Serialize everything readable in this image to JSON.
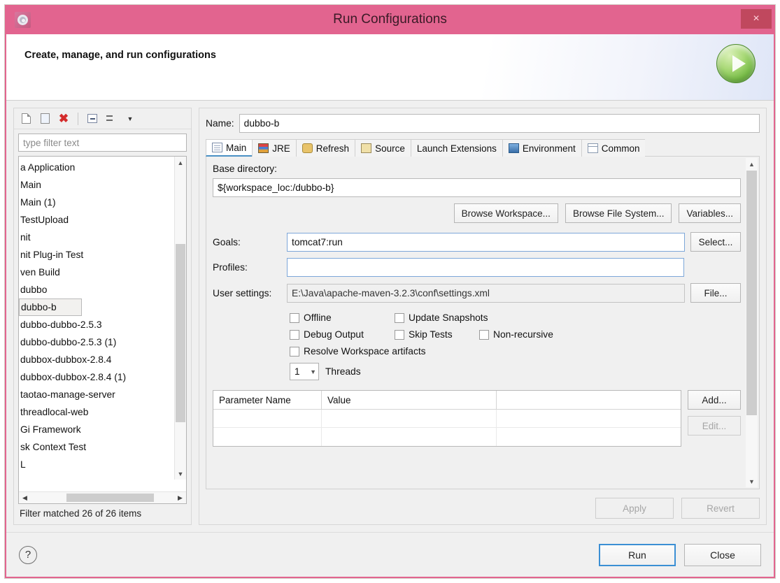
{
  "window": {
    "title": "Run Configurations",
    "close_label": "×",
    "app_icon": "gear-icon"
  },
  "header": {
    "title": "Create, manage, and run configurations",
    "badge_icon": "run-play-icon"
  },
  "sidebar": {
    "toolbar": [
      {
        "name": "new-configuration-icon",
        "glyph": "new"
      },
      {
        "name": "duplicate-configuration-icon",
        "glyph": "copy"
      },
      {
        "name": "delete-configuration-icon",
        "glyph": "delete"
      },
      {
        "name": "collapse-all-icon",
        "glyph": "collapse"
      },
      {
        "name": "filter-configurations-icon",
        "glyph": "filter"
      },
      {
        "name": "view-menu-chevron-icon",
        "glyph": "chevron"
      }
    ],
    "filter": {
      "placeholder": "type filter text",
      "value": ""
    },
    "items": [
      {
        "label": "​a Application",
        "selected": false
      },
      {
        "label": "Main",
        "selected": false
      },
      {
        "label": "Main (1)",
        "selected": false
      },
      {
        "label": "TestUpload",
        "selected": false
      },
      {
        "label": "​nit",
        "selected": false
      },
      {
        "label": "​nit Plug-in Test",
        "selected": false
      },
      {
        "label": "​ven Build",
        "selected": false
      },
      {
        "label": "dubbo",
        "selected": false
      },
      {
        "label": "dubbo-b",
        "selected": true
      },
      {
        "label": "dubbo-dubbo-2.5.3",
        "selected": false
      },
      {
        "label": "dubbo-dubbo-2.5.3 (1)",
        "selected": false
      },
      {
        "label": "dubbox-dubbox-2.8.4",
        "selected": false
      },
      {
        "label": "dubbox-dubbox-2.8.4 (1)",
        "selected": false
      },
      {
        "label": "taotao-manage-server",
        "selected": false
      },
      {
        "label": "threadlocal-web",
        "selected": false
      },
      {
        "label": "Gi Framework",
        "selected": false
      },
      {
        "label": "​sk Context Test",
        "selected": false
      },
      {
        "label": "L",
        "selected": false
      }
    ],
    "status": "Filter matched 26 of 26 items"
  },
  "main": {
    "name_label": "Name:",
    "name_value": "dubbo-b",
    "tabs": [
      {
        "label": "Main",
        "icon": "main-tab-icon",
        "active": true
      },
      {
        "label": "JRE",
        "icon": "jre-tab-icon",
        "active": false
      },
      {
        "label": "Refresh",
        "icon": "refresh-tab-icon",
        "active": false
      },
      {
        "label": "Source",
        "icon": "source-tab-icon",
        "active": false
      },
      {
        "label": "Launch Extensions",
        "icon": "",
        "active": false
      },
      {
        "label": "Environment",
        "icon": "environment-tab-icon",
        "active": false
      },
      {
        "label": "Common",
        "icon": "common-tab-icon",
        "active": false
      }
    ],
    "base_directory": {
      "label": "Base directory:",
      "value": "${workspace_loc:/dubbo-b}",
      "buttons": [
        "Browse Workspace...",
        "Browse File System...",
        "Variables..."
      ]
    },
    "goals": {
      "label": "Goals:",
      "value": "tomcat7:run",
      "button": "Select..."
    },
    "profiles": {
      "label": "Profiles:",
      "value": ""
    },
    "user_settings": {
      "label": "User settings:",
      "value": "E:\\Java\\apache-maven-3.2.3\\conf\\settings.xml",
      "button": "File..."
    },
    "checkboxes": [
      {
        "label": "Offline",
        "checked": false
      },
      {
        "label": "Update Snapshots",
        "checked": false
      },
      {
        "label": "Debug Output",
        "checked": false
      },
      {
        "label": "Skip Tests",
        "checked": false
      },
      {
        "label": "Non-recursive",
        "checked": false
      },
      {
        "label": "Resolve Workspace artifacts",
        "checked": false
      }
    ],
    "threads": {
      "value": "1",
      "label": "Threads"
    },
    "parameters_table": {
      "columns": [
        "Parameter Name",
        "Value",
        ""
      ],
      "rows": [],
      "buttons": [
        {
          "label": "Add...",
          "disabled": false
        },
        {
          "label": "Edit...",
          "disabled": true
        }
      ]
    },
    "apply_label": "Apply",
    "revert_label": "Revert"
  },
  "footer": {
    "help_icon": "help-question-icon",
    "run_label": "Run",
    "close_label": "Close"
  },
  "colors": {
    "accent_pink": "#e2648f",
    "close_red": "#c0485e",
    "focus_blue": "#3b8fd4",
    "run_green": "#72b843"
  }
}
